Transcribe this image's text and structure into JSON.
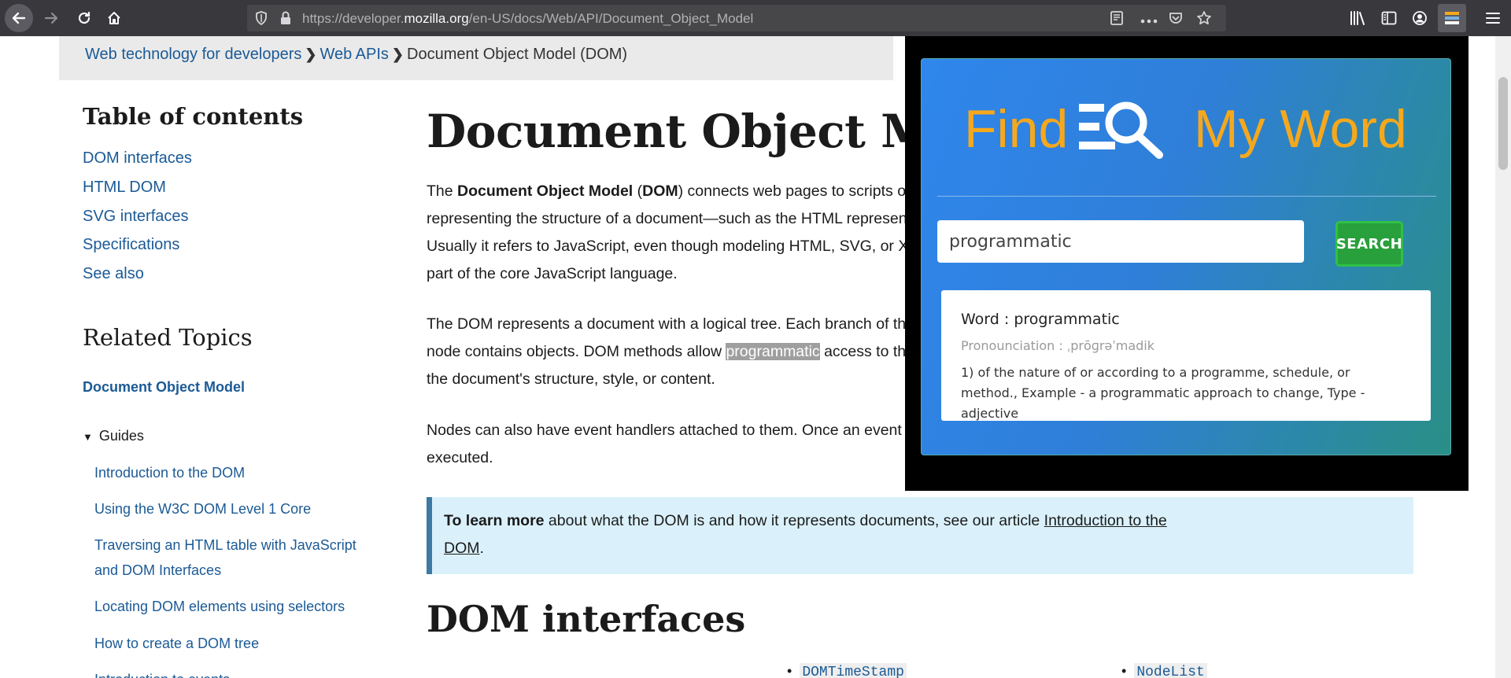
{
  "browser": {
    "url_prefix": "https://developer.",
    "url_host": "mozilla.org",
    "url_path": "/en-US/docs/Web/API/Document_Object_Model"
  },
  "breadcrumb": {
    "items": [
      "Web technology for developers",
      "Web APIs"
    ],
    "current": "Document Object Model (DOM)",
    "separator": "❯"
  },
  "sidebar": {
    "toc_title": "Table of contents",
    "toc_items": [
      "DOM interfaces",
      "HTML DOM",
      "SVG interfaces",
      "Specifications",
      "See also"
    ],
    "related_title": "Related Topics",
    "related_active": "Document Object Model",
    "guides_label": "Guides",
    "guide_items": [
      "Introduction to the DOM",
      "Using the W3C DOM Level 1 Core",
      "Traversing an HTML table with JavaScript",
      "and DOM Interfaces",
      "Locating DOM elements using selectors",
      "How to create a DOM tree",
      "Introduction to events"
    ]
  },
  "article": {
    "title": "Document Object Model (DOM)",
    "p1": {
      "l1_a": "The ",
      "l1_b": "Document Object Model",
      "l1_c": " (",
      "l1_d": "DOM",
      "l1_e": ") connects web pages to scripts or programming languages by",
      "l2": "representing the structure of a document—such as the HTML representing a web page—in memory.",
      "l3": "Usually it refers to JavaScript, even though modeling HTML, SVG, or XML documents as objects are not",
      "l4": "part of the core JavaScript language."
    },
    "p2": {
      "l1": "The DOM represents a document with a logical tree. Each branch of the tree ends in a node, and each",
      "l2_a": "node contains objects. DOM methods allow ",
      "l2_hl": "programmatic",
      "l2_c": " access to the tree. With them, you can change",
      "l3": "the document's structure, style, or content."
    },
    "p3": {
      "l1": "Nodes can also have event handlers attached to them. Once an event is triggered, the event handlers get",
      "l2": "executed."
    },
    "note": {
      "bold": "To learn more",
      "text": " about what the DOM is and how it represents documents, see our article ",
      "link_a": "Introduction to the",
      "link_b": "DOM",
      "end": "."
    },
    "h2": "DOM interfaces",
    "list_items": [
      "DOMTimeStamp",
      "NodeList"
    ]
  },
  "popup": {
    "logo_left": "Find",
    "logo_right": "My Word",
    "search_value": "programmatic",
    "search_button": "SEARCH",
    "result": {
      "word": "Word : programmatic",
      "pronunciation": "Pronounciation : ˌprōɡrəˈmadik",
      "definition": "1) of the nature of or according to a programme, schedule, or method., Example - a programmatic approach to change, Type - adjective"
    },
    "colors": {
      "logo": "#f6a81c",
      "button": "#28a03b",
      "gradient_start": "#2f86ec",
      "gradient_end": "#2a8f86"
    }
  }
}
